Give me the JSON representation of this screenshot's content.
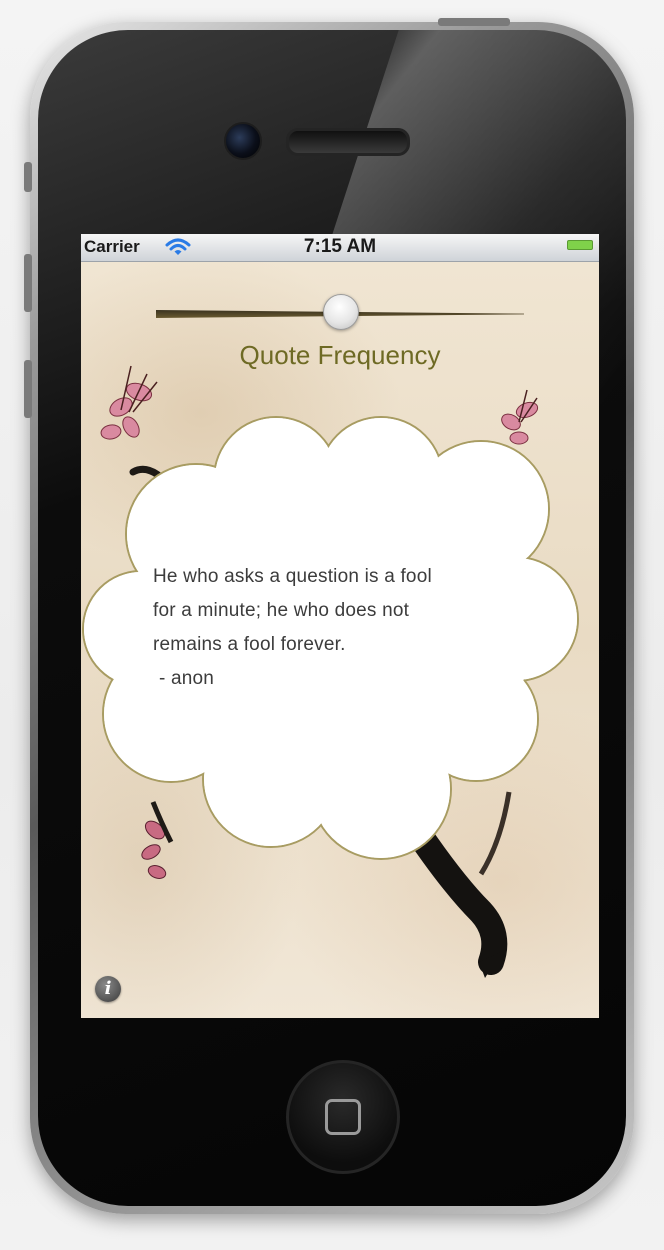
{
  "status_bar": {
    "carrier": "Carrier",
    "wifi_icon": "wifi-icon",
    "time": "7:15 AM",
    "battery_icon": "battery-icon",
    "battery_color": "#7fd14a"
  },
  "slider": {
    "label": "Quote Frequency",
    "value_fraction": 0.5,
    "label_color": "#6e6a24"
  },
  "quote": {
    "lines": [
      "He who asks a question is a fool",
      "for a minute; he who does not",
      "remains a fool forever."
    ],
    "author": " - anon"
  },
  "info_button": {
    "glyph": "i",
    "icon": "info-icon"
  }
}
